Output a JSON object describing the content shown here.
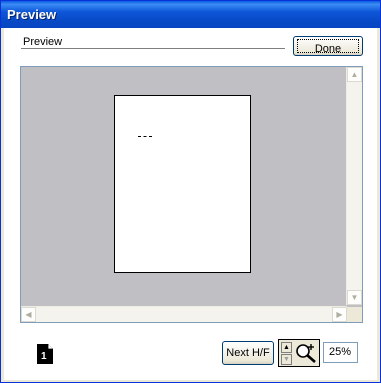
{
  "window": {
    "title": "Preview"
  },
  "header": {
    "label": "Preview",
    "done_label": "Done"
  },
  "footer": {
    "page_number": "1",
    "next_label": "Next H/F",
    "zoom_value": "25%"
  },
  "icons": {
    "scroll_up": "scroll-up-arrow",
    "scroll_down": "scroll-down-arrow",
    "scroll_left": "scroll-left-arrow",
    "scroll_right": "scroll-right-arrow",
    "zoom": "magnifier-plus"
  },
  "colors": {
    "titlebar": "#0a5ae0",
    "preview_background": "#c0bfc4",
    "window_face": "#ece9d8"
  }
}
